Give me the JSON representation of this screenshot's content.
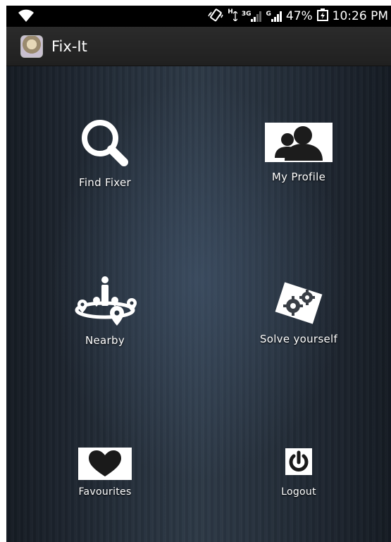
{
  "status_bar": {
    "network_type_small": "H",
    "network_3g": "3G",
    "network_g": "G",
    "battery": "47%",
    "time": "10:26 PM"
  },
  "action_bar": {
    "title": "Fix-It"
  },
  "menu": {
    "find_fixer": "Find Fixer",
    "my_profile": "My Profile",
    "nearby": "Nearby",
    "solve_yourself": "Solve yourself",
    "favourites": "Favourites",
    "logout": "Logout"
  }
}
